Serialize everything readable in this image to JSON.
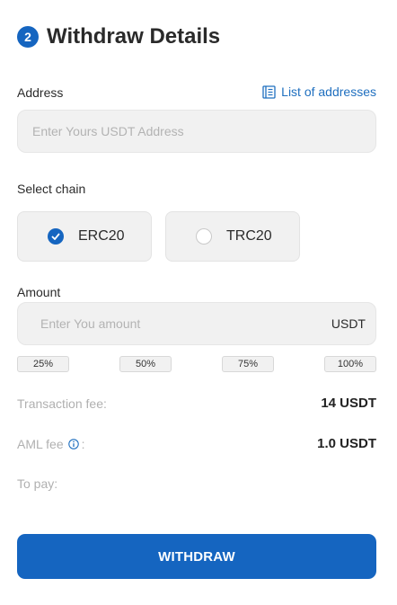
{
  "header": {
    "step_number": "2",
    "title": "Withdraw Details"
  },
  "address": {
    "label": "Address",
    "list_link": "List of addresses",
    "placeholder": "Enter Yours USDT Address",
    "value": ""
  },
  "chain": {
    "label": "Select chain",
    "options": [
      {
        "label": "ERC20",
        "selected": true
      },
      {
        "label": "TRC20",
        "selected": false
      }
    ]
  },
  "amount": {
    "label": "Amount",
    "placeholder": "Enter You amount",
    "value": "",
    "unit": "USDT",
    "presets": [
      "25%",
      "50%",
      "75%",
      "100%"
    ]
  },
  "fees": {
    "transaction_label": "Transaction fee:",
    "transaction_value": "14 USDT",
    "aml_label": "AML fee",
    "aml_suffix": ":",
    "aml_value": "1.0 USDT",
    "to_pay_label": "To pay:",
    "to_pay_value": ""
  },
  "actions": {
    "withdraw_label": "WITHDRAW"
  },
  "colors": {
    "accent": "#1565c0",
    "link": "#1f6fbf",
    "muted": "#b0b0b0",
    "field_bg": "#f1f1f1"
  },
  "icons": {
    "address_list": "list-icon",
    "chain_selected": "check-circle-icon",
    "aml_info": "info-icon"
  }
}
